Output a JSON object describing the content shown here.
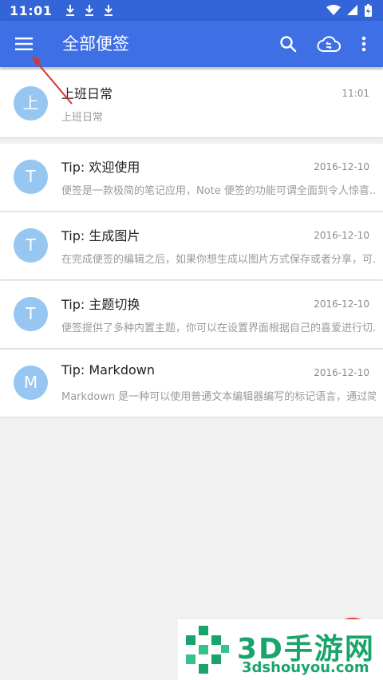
{
  "status_bar": {
    "time": "11:01",
    "icons": [
      "download-icon",
      "download-icon",
      "download-icon",
      "wifi-icon",
      "signal-icon",
      "battery-icon"
    ]
  },
  "app_bar": {
    "title": "全部便签",
    "background": "#3f6fe4",
    "actions": [
      "menu-icon",
      "search-icon",
      "cloud-sync-icon",
      "more-vert-icon"
    ]
  },
  "notes": [
    {
      "avatar": "上",
      "title": "上班日常",
      "date": "11:01",
      "preview": "上班日常"
    },
    {
      "avatar": "T",
      "title": "Tip: 欢迎使用",
      "date": "2016-12-10",
      "preview": "便签是一款极简的笔记应用，Note 便签的功能可谓全面到令人惊喜..."
    },
    {
      "avatar": "T",
      "title": "Tip: 生成图片",
      "date": "2016-12-10",
      "preview": "在完成便签的编辑之后，如果你想生成以图片方式保存或者分享，可..."
    },
    {
      "avatar": "T",
      "title": "Tip: 主题切换",
      "date": "2016-12-10",
      "preview": "便签提供了多种内置主题，你可以在设置界面根据自己的喜爱进行切..."
    },
    {
      "avatar": "M",
      "title": "Tip: Markdown",
      "date": "2016-12-10",
      "preview": "Markdown 是一种可以使用普通文本编辑器编写的标记语言，通过简..."
    }
  ],
  "watermark": {
    "line1": "3D手游网",
    "line2": "3dshouyou.com"
  },
  "colors": {
    "status_bar": "#3364d8",
    "avatar": "#97c7f1",
    "fab": "#e8463f",
    "annotation_arrow": "#d9342b"
  }
}
